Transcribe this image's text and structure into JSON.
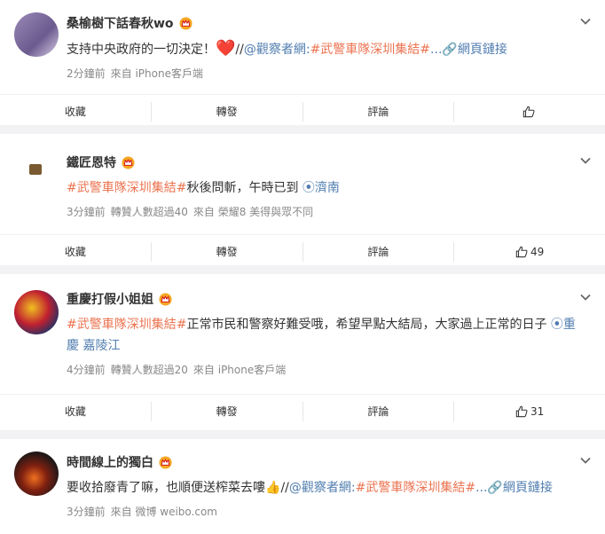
{
  "posts": [
    {
      "name": "桑榆樹下話春秋wo",
      "text_parts": [
        "支持中央政府的一切決定！",
        "❤️",
        "//",
        "@觀察者網",
        ":",
        "#武警車隊深圳集結#",
        "...",
        "網頁鏈接"
      ],
      "meta": [
        "2分鐘前",
        "來自 iPhone客戶端"
      ],
      "actions": [
        "收藏",
        "轉發",
        "評論",
        ""
      ]
    },
    {
      "name": "鐵匠恩特",
      "text_parts": [
        "#武警車隊深圳集結#",
        "秋後問斬，午時已到 ",
        "濟南"
      ],
      "meta": [
        "3分鐘前",
        "轉贊人數超過40",
        "來自 榮耀8 美得與眾不同"
      ],
      "actions": [
        "收藏",
        "轉發",
        "評論",
        "49"
      ]
    },
    {
      "name": "重慶打假小姐姐",
      "text_parts": [
        "#武警車隊深圳集結#",
        "正常市民和警察好難受哦，希望早點大結局，大家過上正常的日子 ",
        "重慶 嘉陵江"
      ],
      "meta": [
        "4分鐘前",
        "轉贊人數超過20",
        "來自 iPhone客戶端"
      ],
      "actions": [
        "收藏",
        "轉發",
        "評論",
        "31"
      ]
    },
    {
      "name": "時間線上的獨白",
      "text_parts": [
        "要收拾廢青了嘛，也順便送榨菜去嘍",
        "👍",
        "//",
        "@觀察者網",
        ":",
        "#武警車隊深圳集結#",
        "...",
        "網頁鏈接"
      ],
      "meta": [
        "3分鐘前",
        "來自 微博 weibo.com"
      ],
      "actions": [
        "收藏",
        "轉發",
        "評論",
        ""
      ]
    }
  ],
  "colors": {
    "topic": "#eb7350",
    "link": "#507daf",
    "crown": "#f5a623"
  }
}
